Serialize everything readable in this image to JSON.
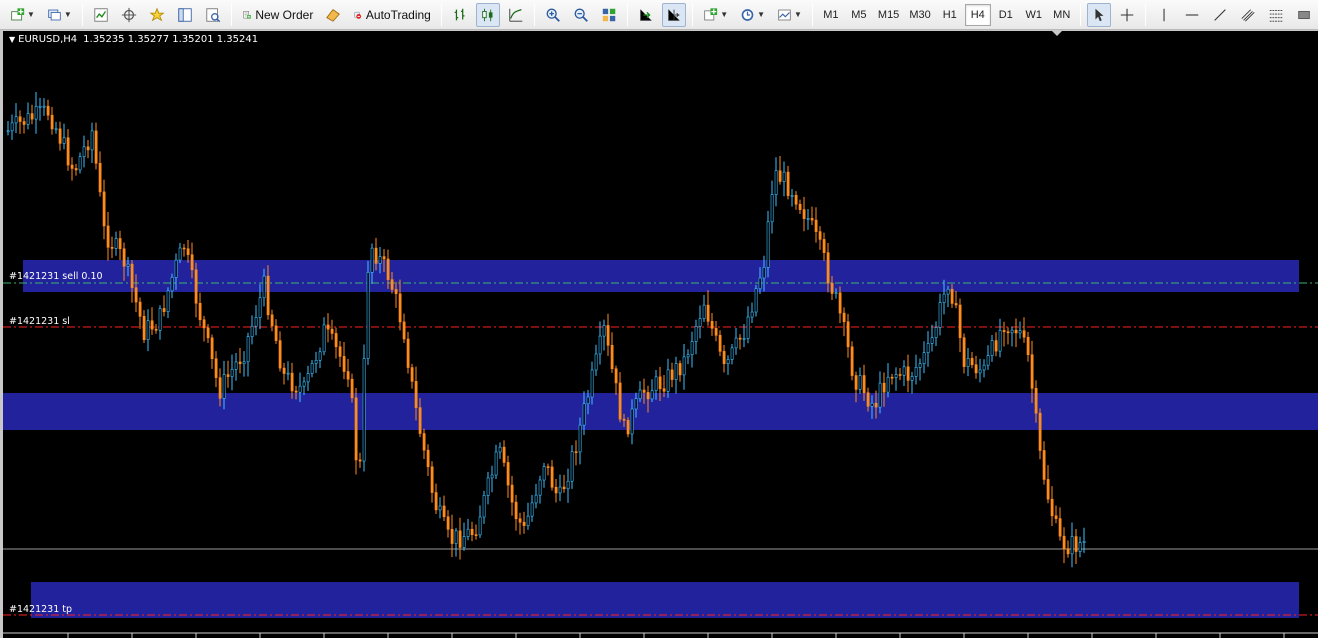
{
  "toolbar": {
    "new_order_label": "New Order",
    "autotrading_label": "AutoTrading",
    "timeframes": [
      "M1",
      "M5",
      "M15",
      "M30",
      "H1",
      "H4",
      "D1",
      "W1",
      "MN"
    ],
    "active_timeframe": "H4"
  },
  "chart": {
    "symbol_period": "EURUSD,H4",
    "ohlc": "1.35235 1.35277 1.35201 1.35241",
    "background": "#000000",
    "bull_color": "#3ec1ff",
    "bear_color": "#ff8c1a",
    "zone_color": "#22229c"
  },
  "order_lines": {
    "entry_label": "#1421231 sell 0.10",
    "sl_label": "#1421231 sl",
    "tp_label": "#1421231 tp",
    "entry_color": "#3cb371",
    "sl_color": "#ff2020",
    "tp_color": "#ff2020"
  },
  "icons": [
    "new-chart-icon",
    "profiles-icon",
    "market-watch-icon",
    "crosshair-view-icon",
    "favorites-icon",
    "navigator-icon",
    "strategy-tester-icon",
    "new-order-icon",
    "meta-editor-icon",
    "autotrading-icon",
    "bar-chart-icon",
    "candlestick-icon",
    "line-chart-icon",
    "zoom-in-icon",
    "zoom-out-icon",
    "tile-windows-icon",
    "autoscroll-icon",
    "chart-shift-icon",
    "indicators-icon",
    "periods-icon",
    "templates-icon",
    "cursor-icon",
    "crosshair-icon",
    "vertical-line-icon",
    "horizontal-line-icon",
    "trendline-icon",
    "channel-icon",
    "fibonacci-icon",
    "text-icon"
  ]
}
